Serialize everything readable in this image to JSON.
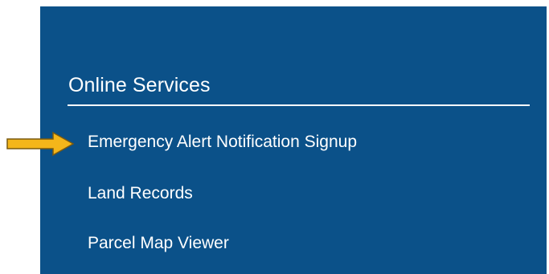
{
  "online_services": {
    "heading": "Online Services",
    "links": [
      {
        "label": "Emergency Alert Notification Signup"
      },
      {
        "label": "Land Records"
      },
      {
        "label": "Parcel Map Viewer"
      }
    ]
  },
  "colors": {
    "panel_background": "#0b5189",
    "text": "#ffffff",
    "arrow_fill": "#f4b61a",
    "arrow_outline": "#7a5a10"
  },
  "icons": {
    "pointer": "arrow-right-icon"
  }
}
